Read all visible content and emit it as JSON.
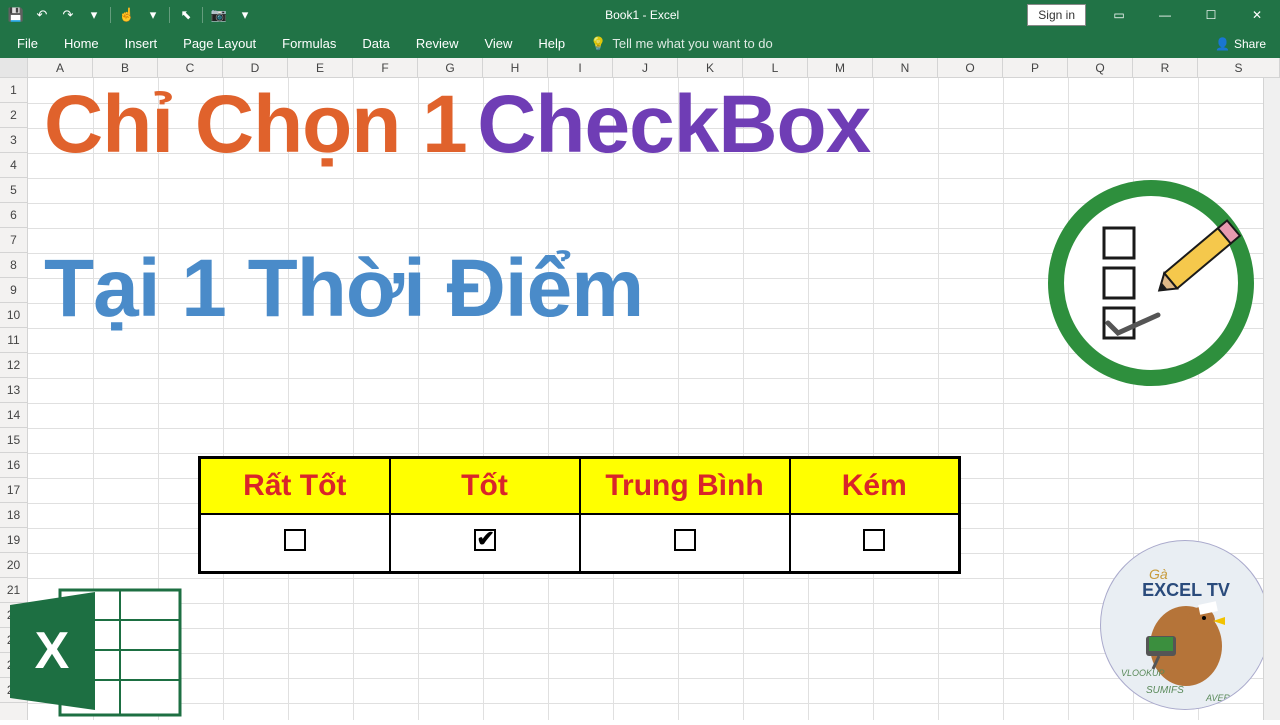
{
  "app": {
    "title": "Book1  -  Excel"
  },
  "qat": {
    "save": "💾",
    "undo": "↶",
    "redo": "↷",
    "customize": "▾",
    "touch": "☝",
    "dropdown2": "▾",
    "pointer": "⬉",
    "camera": "📷",
    "dropdown3": "▾"
  },
  "window": {
    "signin": "Sign in",
    "ribbonopt": "▭",
    "min": "—",
    "max": "☐",
    "close": "✕"
  },
  "tabs": {
    "items": [
      "File",
      "Home",
      "Insert",
      "Page Layout",
      "Formulas",
      "Data",
      "Review",
      "View",
      "Help"
    ],
    "tellme_icon": "💡",
    "tellme": "Tell me what you want to do",
    "share_icon": "👤",
    "share": "Share"
  },
  "columns": [
    "A",
    "B",
    "C",
    "D",
    "E",
    "F",
    "G",
    "H",
    "I",
    "J",
    "K",
    "L",
    "M",
    "N",
    "O",
    "P",
    "Q",
    "R",
    "S"
  ],
  "rows": [
    "1",
    "2",
    "3",
    "4",
    "5",
    "6",
    "7",
    "8",
    "9",
    "10",
    "11",
    "12",
    "13",
    "14",
    "15",
    "16",
    "17",
    "18",
    "19",
    "20",
    "21",
    "22",
    "23",
    "24",
    "25"
  ],
  "headline": {
    "part1": "Chỉ Chọn 1",
    "part2": "CheckBox",
    "line2": "Tại 1 Thời Điểm"
  },
  "rating": {
    "headers": [
      "Rất Tốt",
      "Tốt",
      "Trung Bình",
      "Kém"
    ],
    "checked_index": 1
  },
  "watermark": {
    "brand": "EXCEL TV",
    "prefix": "Gà"
  }
}
